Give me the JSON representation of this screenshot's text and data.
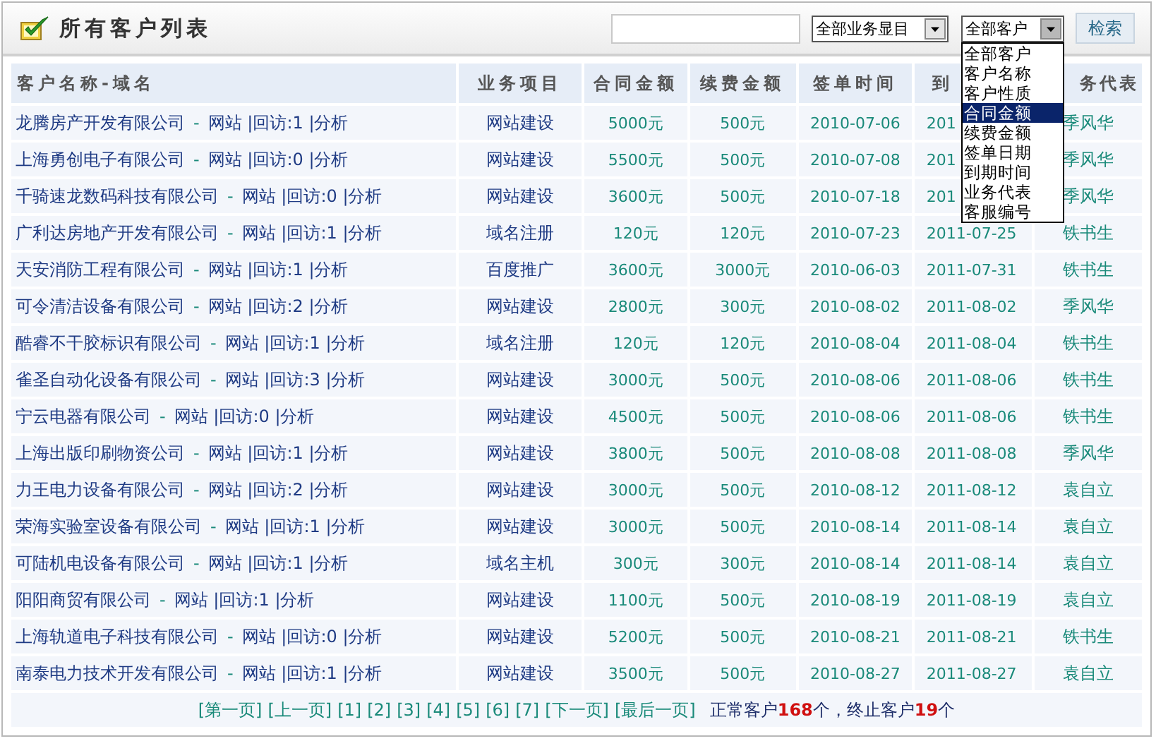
{
  "header": {
    "title": "所有客户列表"
  },
  "filters": [
    {
      "label": "全部业务显目"
    },
    {
      "label": "全部客户",
      "expanded": true,
      "options": [
        {
          "label": "全部客户",
          "selected": false
        },
        {
          "label": "客户名称",
          "selected": false
        },
        {
          "label": "客户性质",
          "selected": false
        },
        {
          "label": "合同金额",
          "selected": true
        },
        {
          "label": "续费金额",
          "selected": false
        },
        {
          "label": "签单日期",
          "selected": false
        },
        {
          "label": "到期时间",
          "selected": false
        },
        {
          "label": "业务代表",
          "selected": false
        },
        {
          "label": "客服编号",
          "selected": false
        }
      ]
    }
  ],
  "search_button": "检索",
  "table": {
    "columns": [
      "客户名称-域名",
      "业务项目",
      "合同金额",
      "续费金额",
      "签单时间",
      "到",
      "务代表"
    ],
    "rows": [
      {
        "name": "龙腾房产开发有限公司",
        "separator": "-",
        "links": "网站 |回访:1 |分析",
        "service": "网站建设",
        "contract": "5000元",
        "renewal": "500元",
        "signed": "2010-07-06",
        "due": "201",
        "rep": "季风华"
      },
      {
        "name": "上海勇创电子有限公司",
        "separator": "-",
        "links": "网站 |回访:0 |分析",
        "service": "网站建设",
        "contract": "5500元",
        "renewal": "500元",
        "signed": "2010-07-08",
        "due": "201",
        "rep": "季风华"
      },
      {
        "name": "千骑速龙数码科技有限公司",
        "separator": "-",
        "links": "网站 |回访:0 |分析",
        "service": "网站建设",
        "contract": "3600元",
        "renewal": "500元",
        "signed": "2010-07-18",
        "due": "201",
        "rep": "季风华"
      },
      {
        "name": "广利达房地产开发有限公司",
        "separator": "-",
        "links": "网站 |回访:1 |分析",
        "service": "域名注册",
        "contract": "120元",
        "renewal": "120元",
        "signed": "2010-07-23",
        "due": "2011-07-25",
        "rep": "铁书生"
      },
      {
        "name": "天安消防工程有限公司",
        "separator": "-",
        "links": "网站 |回访:1 |分析",
        "service": "百度推广",
        "contract": "3600元",
        "renewal": "3000元",
        "signed": "2010-06-03",
        "due": "2011-07-31",
        "rep": "铁书生"
      },
      {
        "name": "可令清洁设备有限公司",
        "separator": "-",
        "links": "网站 |回访:2 |分析",
        "service": "网站建设",
        "contract": "2800元",
        "renewal": "300元",
        "signed": "2010-08-02",
        "due": "2011-08-02",
        "rep": "季风华"
      },
      {
        "name": "酷睿不干胶标识有限公司",
        "separator": "-",
        "links": "网站 |回访:1 |分析",
        "service": "域名注册",
        "contract": "120元",
        "renewal": "120元",
        "signed": "2010-08-04",
        "due": "2011-08-04",
        "rep": "铁书生"
      },
      {
        "name": "雀圣自动化设备有限公司",
        "separator": "-",
        "links": "网站 |回访:3 |分析",
        "service": "网站建设",
        "contract": "3000元",
        "renewal": "500元",
        "signed": "2010-08-06",
        "due": "2011-08-06",
        "rep": "铁书生"
      },
      {
        "name": "宁云电器有限公司",
        "separator": "-",
        "links": "网站 |回访:0 |分析",
        "service": "网站建设",
        "contract": "4500元",
        "renewal": "500元",
        "signed": "2010-08-06",
        "due": "2011-08-06",
        "rep": "铁书生"
      },
      {
        "name": "上海出版印刷物资公司",
        "separator": "-",
        "links": "网站 |回访:1 |分析",
        "service": "网站建设",
        "contract": "3800元",
        "renewal": "500元",
        "signed": "2010-08-08",
        "due": "2011-08-08",
        "rep": "季风华"
      },
      {
        "name": "力王电力设备有限公司",
        "separator": "-",
        "links": "网站 |回访:2 |分析",
        "service": "网站建设",
        "contract": "3000元",
        "renewal": "500元",
        "signed": "2010-08-12",
        "due": "2011-08-12",
        "rep": "袁自立"
      },
      {
        "name": "荣海实验室设备有限公司",
        "separator": "-",
        "links": "网站 |回访:1 |分析",
        "service": "网站建设",
        "contract": "3000元",
        "renewal": "500元",
        "signed": "2010-08-14",
        "due": "2011-08-14",
        "rep": "袁自立"
      },
      {
        "name": "可陆机电设备有限公司",
        "separator": "-",
        "links": "网站 |回访:1 |分析",
        "service": "域名主机",
        "contract": "300元",
        "renewal": "300元",
        "signed": "2010-08-14",
        "due": "2011-08-14",
        "rep": "袁自立"
      },
      {
        "name": "阳阳商贸有限公司",
        "separator": "-",
        "links": "网站 |回访:1 |分析",
        "service": "网站建设",
        "contract": "1100元",
        "renewal": "500元",
        "signed": "2010-08-19",
        "due": "2011-08-19",
        "rep": "袁自立"
      },
      {
        "name": "上海轨道电子科技有限公司",
        "separator": "-",
        "links": "网站 |回访:0 |分析",
        "service": "网站建设",
        "contract": "5200元",
        "renewal": "500元",
        "signed": "2010-08-21",
        "due": "2011-08-21",
        "rep": "铁书生"
      },
      {
        "name": "南泰电力技术开发有限公司",
        "separator": "-",
        "links": "网站 |回访:1 |分析",
        "service": "网站建设",
        "contract": "3500元",
        "renewal": "500元",
        "signed": "2010-08-27",
        "due": "2011-08-27",
        "rep": "袁自立"
      }
    ]
  },
  "pagination": {
    "links": [
      "[第一页]",
      "[上一页]",
      "[1]",
      "[2]",
      "[3]",
      "[4]",
      "[5]",
      "[6]",
      "[7]",
      "[下一页]",
      "[最后一页]"
    ],
    "summary": "正常客户**168**个，终止客户**19**个"
  }
}
